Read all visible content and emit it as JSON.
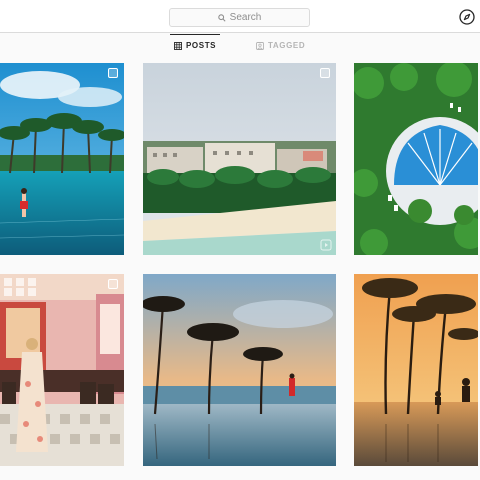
{
  "search": {
    "placeholder": "Search"
  },
  "tabs": [
    {
      "label": "POSTS",
      "active": true
    },
    {
      "label": "TAGGED",
      "active": false
    }
  ],
  "icons": {
    "search": "search-icon",
    "explore": "compass-icon",
    "posts": "grid-icon",
    "tagged": "tag-icon",
    "multi": "multiple-photos-icon",
    "video": "video-icon"
  },
  "colors": {
    "border": "#dbdbdb",
    "muted": "#8e8e8e",
    "text": "#262626",
    "background": "#fafafa"
  }
}
